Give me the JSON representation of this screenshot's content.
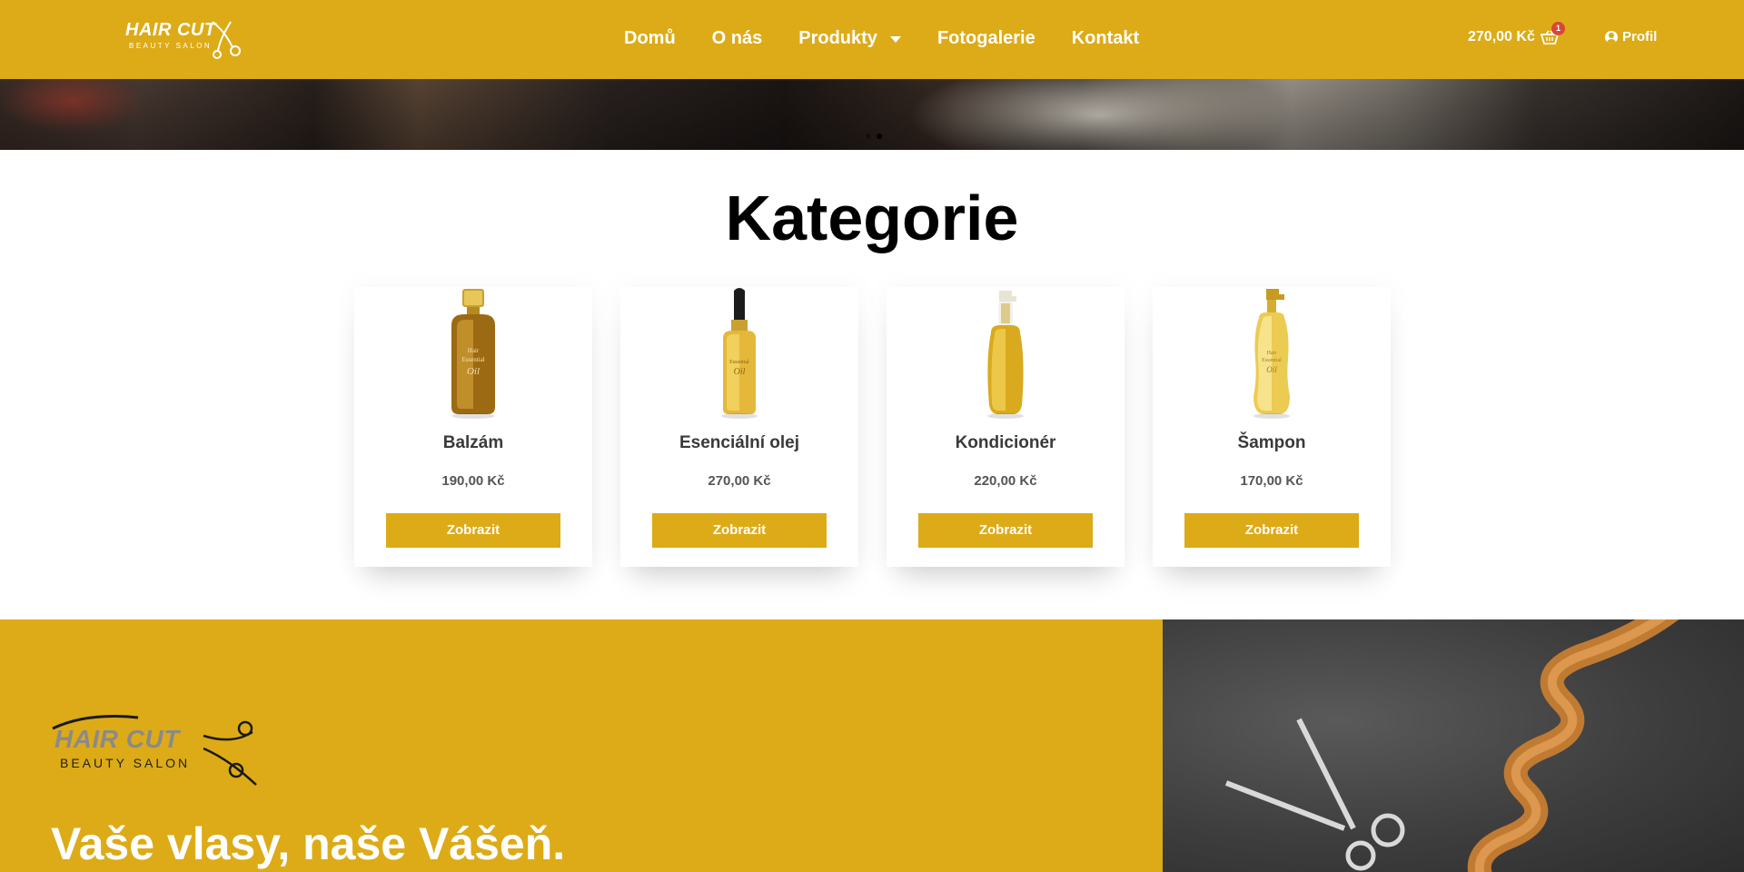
{
  "logo": {
    "brand": "HAIR CUT",
    "sub": "BEAUTY SALON"
  },
  "nav": {
    "items": [
      "Domů",
      "O nás",
      "Produkty",
      "Fotogalerie",
      "Kontakt"
    ]
  },
  "cart": {
    "total": "270,00 Kč",
    "count": "1"
  },
  "profile": {
    "label": "Profil"
  },
  "hero": {
    "slides": 2,
    "active_slide": 2
  },
  "categories": {
    "title": "Kategorie",
    "items": [
      {
        "name": "Balzám",
        "price": "190,00 Kč",
        "button": "Zobrazit"
      },
      {
        "name": "Esenciální olej",
        "price": "270,00 Kč",
        "button": "Zobrazit"
      },
      {
        "name": "Kondicionér",
        "price": "220,00 Kč",
        "button": "Zobrazit"
      },
      {
        "name": "Šampon",
        "price": "170,00 Kč",
        "button": "Zobrazit"
      }
    ]
  },
  "promo": {
    "brand": "HAIR CUT",
    "sub": "BEAUTY SALON",
    "tagline": "Vaše vlasy, naše Vášeň."
  },
  "colors": {
    "accent": "#DDAB17",
    "badge": "#D8463A",
    "text_dark": "#000000"
  }
}
